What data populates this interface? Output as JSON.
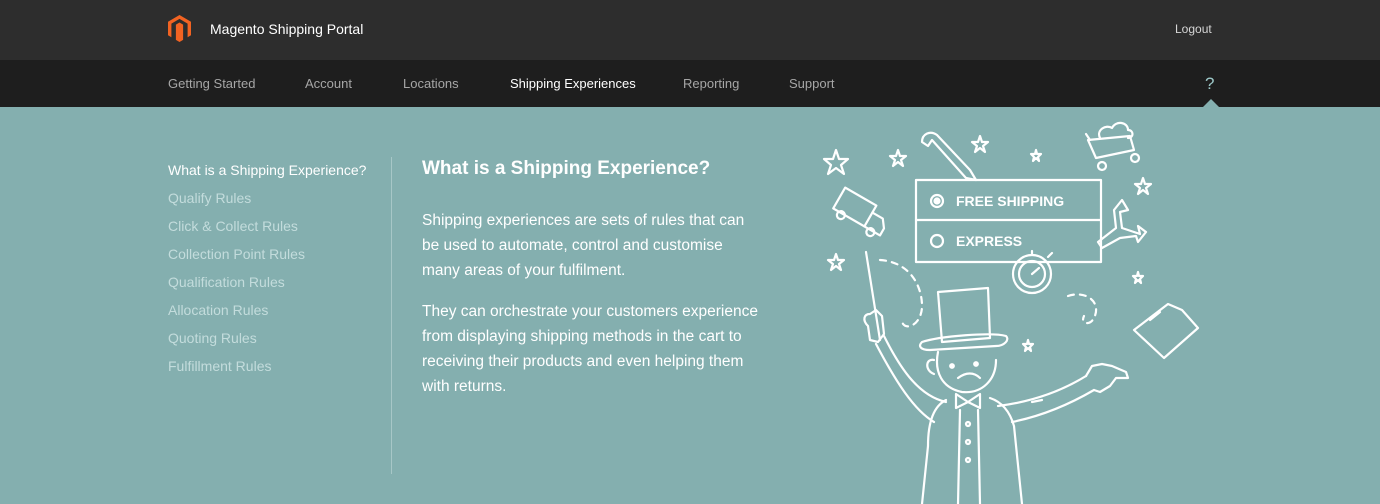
{
  "header": {
    "brand": "Magento Shipping Portal",
    "logout_label": "Logout",
    "logo_color": "#f26322"
  },
  "nav": {
    "items": [
      {
        "label": "Getting Started"
      },
      {
        "label": "Account"
      },
      {
        "label": "Locations"
      },
      {
        "label": "Shipping Experiences",
        "active": true
      },
      {
        "label": "Reporting"
      },
      {
        "label": "Support"
      }
    ],
    "help_label": "?"
  },
  "sidebar": {
    "items": [
      {
        "label": "What is a Shipping Experience?",
        "active": true
      },
      {
        "label": "Qualify Rules"
      },
      {
        "label": "Click & Collect Rules"
      },
      {
        "label": "Collection Point Rules"
      },
      {
        "label": "Qualification Rules"
      },
      {
        "label": "Allocation Rules"
      },
      {
        "label": "Quoting Rules"
      },
      {
        "label": "Fulfillment Rules"
      }
    ]
  },
  "content": {
    "title": "What is a Shipping Experience?",
    "paragraphs": [
      "Shipping experiences are sets of rules that can be used to automate, control and customise many areas of your fulfilment.",
      "They can orchestrate your customers experience from displaying shipping methods in the cart to receiving their products and even helping them with returns."
    ]
  },
  "illustration": {
    "option_free": "FREE SHIPPING",
    "option_express": "EXPRESS"
  },
  "colors": {
    "background": "#84afaf",
    "topbar": "#2d2d2d",
    "navbar": "#1e1e1e"
  }
}
